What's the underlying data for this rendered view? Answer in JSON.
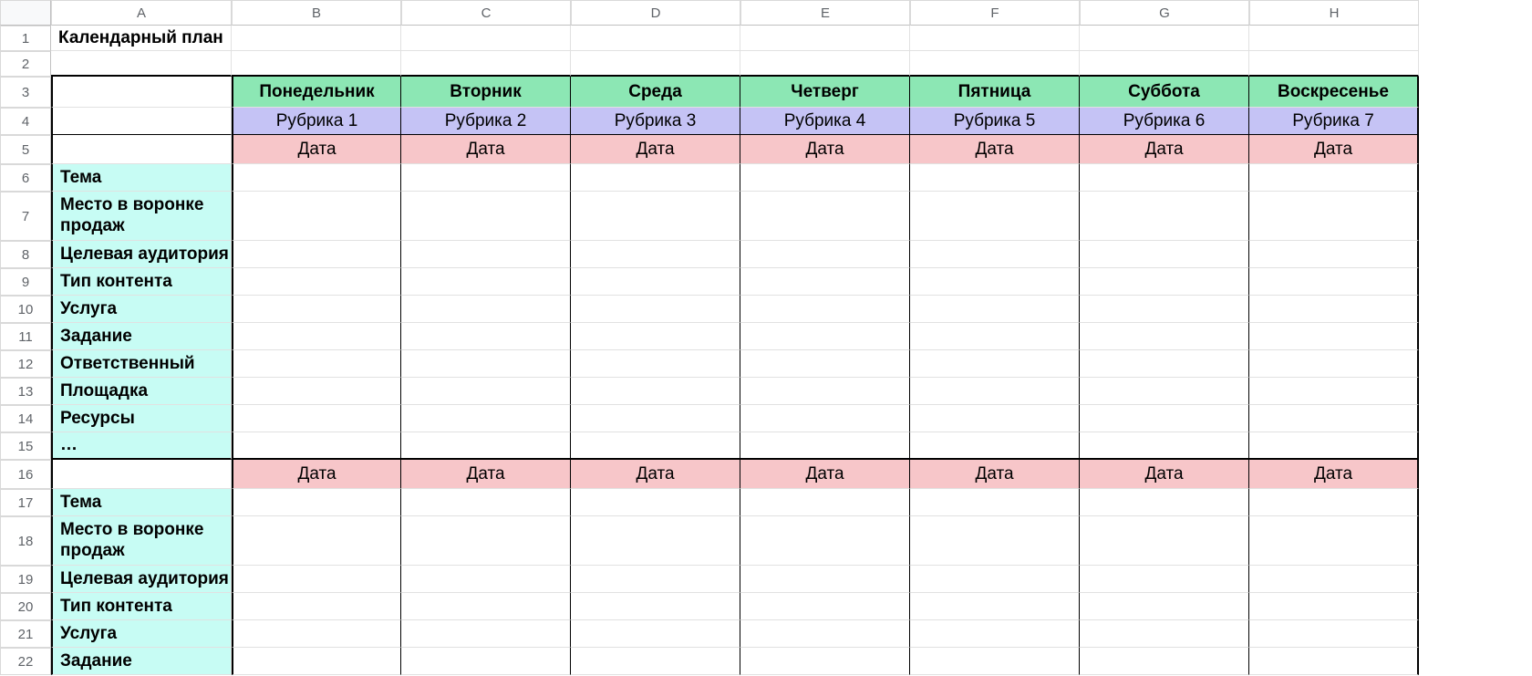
{
  "columns": [
    "A",
    "B",
    "C",
    "D",
    "E",
    "F",
    "G",
    "H"
  ],
  "row_numbers": [
    1,
    2,
    3,
    4,
    5,
    6,
    7,
    8,
    9,
    10,
    11,
    12,
    13,
    14,
    15,
    16,
    17,
    18,
    19,
    20,
    21,
    22
  ],
  "a1": "Календарный план",
  "days": [
    "Понедельник",
    "Вторник",
    "Среда",
    "Четверг",
    "Пятница",
    "Суббота",
    "Воскресенье"
  ],
  "rubrics": [
    "Рубрика 1",
    "Рубрика 2",
    "Рубрика 3",
    "Рубрика 4",
    "Рубрика 5",
    "Рубрика 6",
    "Рубрика 7"
  ],
  "date_label": "Дата",
  "labels_block1": [
    "Тема",
    "Место в воронке продаж",
    "Целевая аудитория",
    "Тип контента",
    "Услуга",
    "Задание",
    "Ответственный",
    "Площадка",
    "Ресурсы",
    "…"
  ],
  "labels_block2": [
    "Тема",
    "Место в воронке продаж",
    "Целевая аудитория",
    "Тип контента",
    "Услуга",
    "Задание"
  ]
}
